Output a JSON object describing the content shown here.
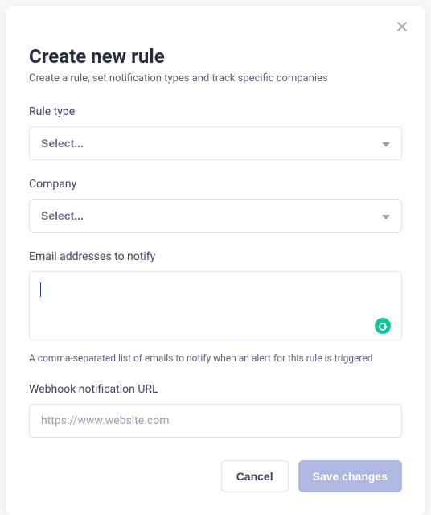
{
  "modal": {
    "title": "Create new rule",
    "subtitle": "Create a rule, set notification types and track specific companies"
  },
  "fields": {
    "rule_type": {
      "label": "Rule type",
      "selected": "Select..."
    },
    "company": {
      "label": "Company",
      "selected": "Select..."
    },
    "emails": {
      "label": "Email addresses to notify",
      "value": "",
      "help": "A comma-separated list of emails to notify when an alert for this rule is triggered"
    },
    "webhook": {
      "label": "Webhook notification URL",
      "placeholder": "https://www.website.com",
      "value": ""
    }
  },
  "buttons": {
    "cancel": "Cancel",
    "save": "Save changes"
  },
  "icons": {
    "close": "close-icon",
    "caret": "caret-down-icon",
    "grammarly": "grammarly-icon"
  },
  "colors": {
    "accent_disabled": "#afb8e0",
    "text_primary": "#282c3f",
    "text_secondary": "#5b6278",
    "border": "#dfe2ea",
    "grammarly": "#15c39a"
  }
}
